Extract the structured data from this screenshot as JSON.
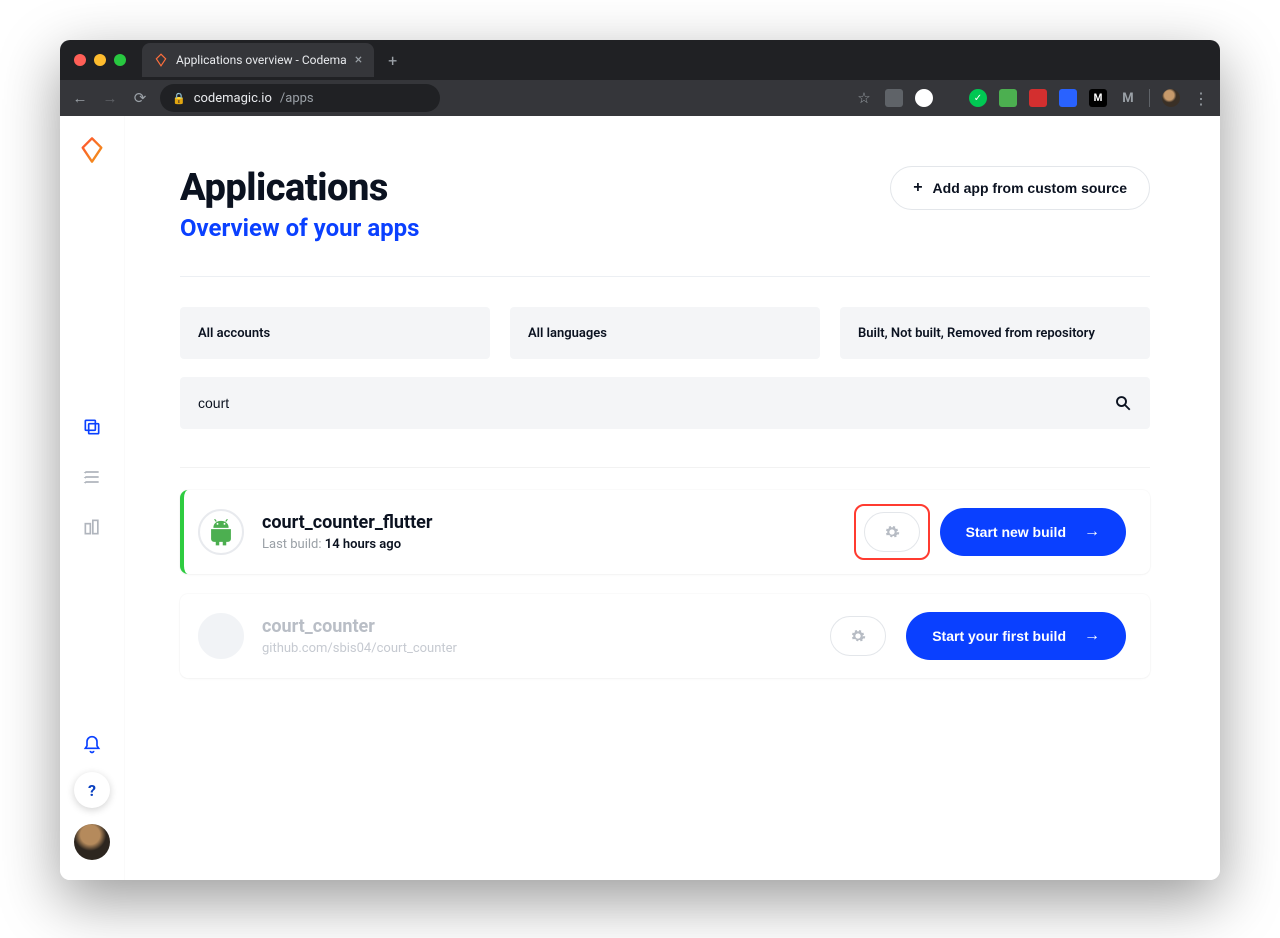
{
  "browser": {
    "tab_title": "Applications overview - Codema",
    "url_host": "codemagic.io",
    "url_path": "/apps"
  },
  "header": {
    "title": "Applications",
    "subtitle": "Overview of your apps",
    "add_button": "Add app from custom source"
  },
  "filters": {
    "account": "All accounts",
    "language": "All languages",
    "status": "Built, Not built, Removed from repository"
  },
  "search": {
    "value": "court"
  },
  "apps": [
    {
      "name": "court_counter_flutter",
      "sub_label": "Last build:",
      "sub_value": "14 hours ago",
      "action": "Start new build",
      "highlighted": true,
      "platform": "android"
    },
    {
      "name": "court_counter",
      "sub_label": "github.com/sbis04/court_counter",
      "sub_value": "",
      "action": "Start your first build",
      "highlighted": false,
      "platform": "none"
    }
  ],
  "sidebar": {
    "help": "?"
  }
}
